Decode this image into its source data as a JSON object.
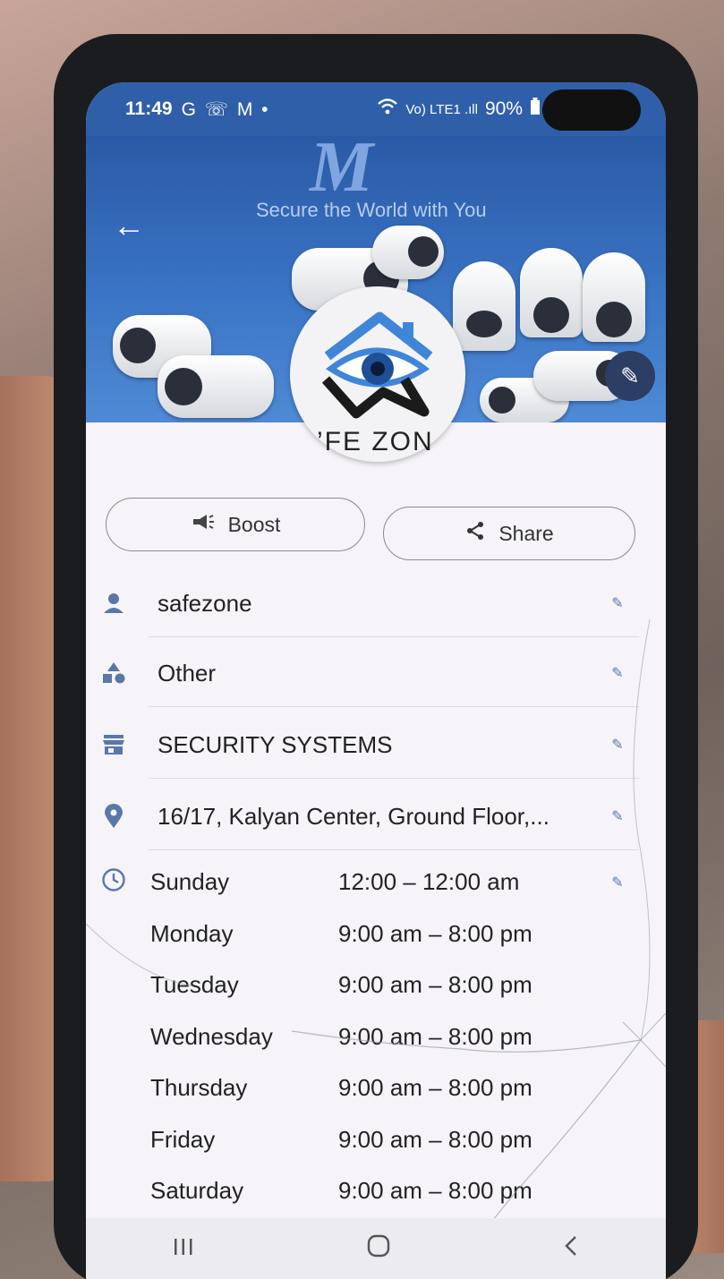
{
  "status_bar": {
    "time": "11:49",
    "notification_icons": "G ☏ M •",
    "network": "Vo) LTE1 .ıll",
    "battery": "90%"
  },
  "cover": {
    "slogan": "Secure the World with You",
    "brand_mark": "M"
  },
  "profile": {
    "name_partial": "’FE ZON"
  },
  "actions": {
    "boost_label": "Boost",
    "share_label": "Share"
  },
  "info": {
    "username": "safezone",
    "category": "Other",
    "business_type": "SECURITY SYSTEMS",
    "address": "16/17, Kalyan Center, Ground Floor,..."
  },
  "hours": [
    {
      "day": "Sunday",
      "time": "12:00 – 12:00 am"
    },
    {
      "day": "Monday",
      "time": "9:00 am – 8:00 pm"
    },
    {
      "day": "Tuesday",
      "time": "9:00 am – 8:00 pm"
    },
    {
      "day": "Wednesday",
      "time": "9:00 am – 8:00 pm"
    },
    {
      "day": "Thursday",
      "time": "9:00 am – 8:00 pm"
    },
    {
      "day": "Friday",
      "time": "9:00 am – 8:00 pm"
    },
    {
      "day": "Saturday",
      "time": "9:00 am – 8:00 pm"
    }
  ],
  "nav": {
    "recents_icon": "recents-icon",
    "home_icon": "home-icon",
    "back_icon": "back-icon"
  },
  "colors": {
    "status_bar": "#2f5fa8",
    "accent_icon": "#5a77aa",
    "screen_bg": "#f6f4f8"
  }
}
